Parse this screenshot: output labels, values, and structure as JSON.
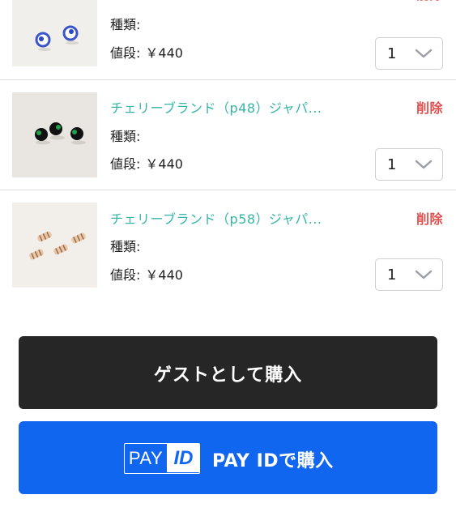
{
  "cart": {
    "items": [
      {
        "title": "",
        "delete_label": "削除",
        "kind_label": "種類:",
        "price_label": "値段:",
        "price_value": "￥440",
        "quantity": "1",
        "image": "blue-white glass beads"
      },
      {
        "title": "チェリーブランド（p48）ジャパ...",
        "delete_label": "削除",
        "kind_label": "種類:",
        "price_label": "値段:",
        "price_value": "￥440",
        "quantity": "1",
        "image": "green-black glass beads"
      },
      {
        "title": "チェリーブランド（p58）ジャパ...",
        "delete_label": "削除",
        "kind_label": "種類:",
        "price_label": "値段:",
        "price_value": "￥440",
        "quantity": "1",
        "image": "striped pink-gold tube beads"
      }
    ]
  },
  "actions": {
    "guest_label": "ゲストとして購入",
    "payid_logo_pay": "PAY",
    "payid_logo_id": "ID",
    "payid_label": "PAY IDで購入"
  },
  "colors": {
    "title": "#35b5a7",
    "delete": "#e05050",
    "guest_button": "#262626",
    "payid_button": "#1166f0"
  }
}
